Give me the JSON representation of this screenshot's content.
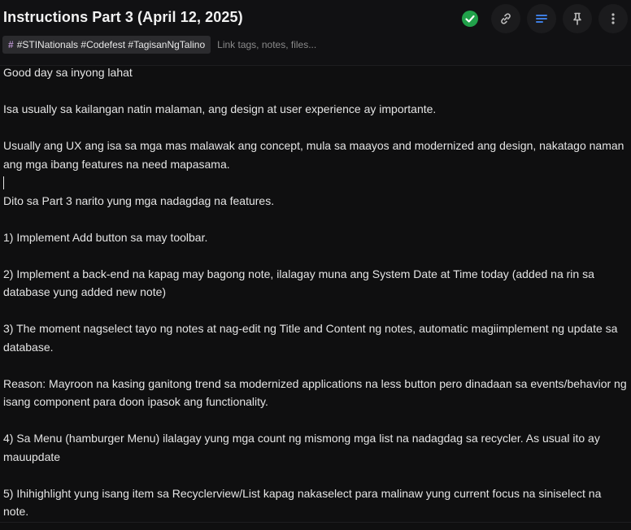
{
  "note": {
    "title": "Instructions Part 3 (April 12, 2025)",
    "tags": "#STINationals #Codefest #TagisanNgTalino",
    "tags_placeholder": "Link tags, notes, files...",
    "paragraphs": [
      "Good day sa inyong lahat",
      "",
      "Isa usually sa kailangan natin malaman, ang design at user experience ay importante.",
      "",
      "Usually ang UX ang isa sa mga mas malawak ang concept, mula sa maayos and modernized ang design, nakatago naman ang mga ibang features na need mapasama.",
      "",
      "Dito sa Part 3 narito yung mga nadagdag na features.",
      "",
      "1) Implement Add button sa may toolbar.",
      "",
      "2) Implement a back-end na kapag may bagong note, ilalagay muna ang System Date at Time today (added na rin sa database yung added new note)",
      "",
      "3) The moment nagselect tayo ng notes at nag-edit ng Title and Content ng notes, automatic magiimplement ng update sa database.",
      "",
      "Reason: Mayroon na kasing ganitong trend sa modernized applications na less button pero dinadaan sa events/behavior ng isang component para doon ipasok ang functionality.",
      "",
      "4) Sa Menu (hamburger Menu) ilalagay yung mga count ng mismong mga list na nadagdag sa recycler. As usual ito ay mauupdate",
      "",
      "5) Ihihighlight yung isang item sa Recyclerview/List kapag nakaselect para malinaw yung current focus na siniselect na note."
    ]
  },
  "toolbar": {
    "icons": [
      "check-circle-icon",
      "link-icon",
      "list-icon",
      "pin-icon",
      "more-vertical-icon"
    ]
  },
  "colors": {
    "accent_green": "#21a14a",
    "accent_blue": "#3d7de0",
    "background": "#0f0f10",
    "text": "#e4e4e4"
  }
}
